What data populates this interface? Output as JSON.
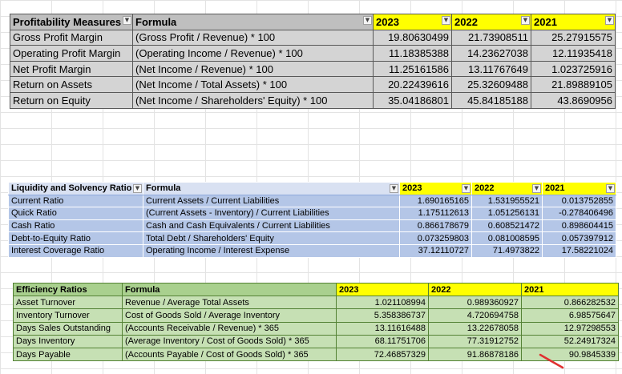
{
  "profitability": {
    "headers": [
      "Profitability Measures",
      "Formula",
      "2023",
      "2022",
      "2021"
    ],
    "rows": [
      [
        "Gross Profit Margin",
        "(Gross Profit / Revenue) * 100",
        "19.80630499",
        "21.73908511",
        "25.27915575"
      ],
      [
        "Operating Profit Margin",
        "(Operating Income / Revenue) * 100",
        "11.18385388",
        "14.23627038",
        "12.11935418"
      ],
      [
        "Net Profit Margin",
        "(Net Income / Revenue) * 100",
        "11.25161586",
        "13.11767649",
        "1.023725916"
      ],
      [
        "Return on Assets",
        "(Net Income / Total Assets) * 100",
        "20.22439616",
        "25.32609488",
        "21.89889105"
      ],
      [
        "Return on Equity",
        "(Net Income / Shareholders' Equity) * 100",
        "35.04186801",
        "45.84185188",
        "43.8690956"
      ]
    ]
  },
  "liquidity": {
    "headers": [
      "Liquidity and Solvency Ratio",
      "Formula",
      "2023",
      "2022",
      "2021"
    ],
    "rows": [
      [
        "Current Ratio",
        "Current Assets / Current Liabilities",
        "1.690165165",
        "1.531955521",
        "0.013752855"
      ],
      [
        "Quick Ratio",
        "(Current Assets - Inventory) / Current Liabilities",
        "1.175112613",
        "1.051256131",
        "-0.278406496"
      ],
      [
        "Cash Ratio",
        "Cash and Cash Equivalents / Current Liabilities",
        "0.866178679",
        "0.608521472",
        "0.898604415"
      ],
      [
        "Debt-to-Equity Ratio",
        "Total Debt / Shareholders' Equity",
        "0.073259803",
        "0.081008595",
        "0.057397912"
      ],
      [
        "Interest Coverage Ratio",
        "Operating Income / Interest Expense",
        "37.12110727",
        "71.4973822",
        "17.58221024"
      ]
    ]
  },
  "efficiency": {
    "headers": [
      "Efficiency Ratios",
      "Formula",
      "2023",
      "2022",
      "2021"
    ],
    "rows": [
      [
        "Asset Turnover",
        "Revenue / Average Total Assets",
        "1.021108994",
        "0.989360927",
        "0.866282532"
      ],
      [
        "Inventory Turnover",
        "Cost of Goods Sold / Average Inventory",
        "5.358386737",
        "4.720694758",
        "6.98575647"
      ],
      [
        "Days Sales Outstanding",
        "(Accounts Receivable / Revenue) * 365",
        "13.11616488",
        "13.22678058",
        "12.97298553"
      ],
      [
        "Days Inventory",
        "(Average Inventory / Cost of Goods Sold) * 365",
        "68.11751706",
        "77.31912752",
        "52.24917324"
      ],
      [
        "Days Payable",
        "(Accounts Payable / Cost of Goods Sold) * 365",
        "72.46857329",
        "91.86878186",
        "90.9845339"
      ]
    ]
  },
  "colors": {
    "year_header": "#ffff00",
    "profitability_row": "#d4d4d4",
    "liquidity_row": "#b4c6e7",
    "efficiency_row": "#c6e0b4",
    "annotation": "#e03030"
  },
  "icons": {
    "filter_dropdown": "chevron-down-icon"
  }
}
